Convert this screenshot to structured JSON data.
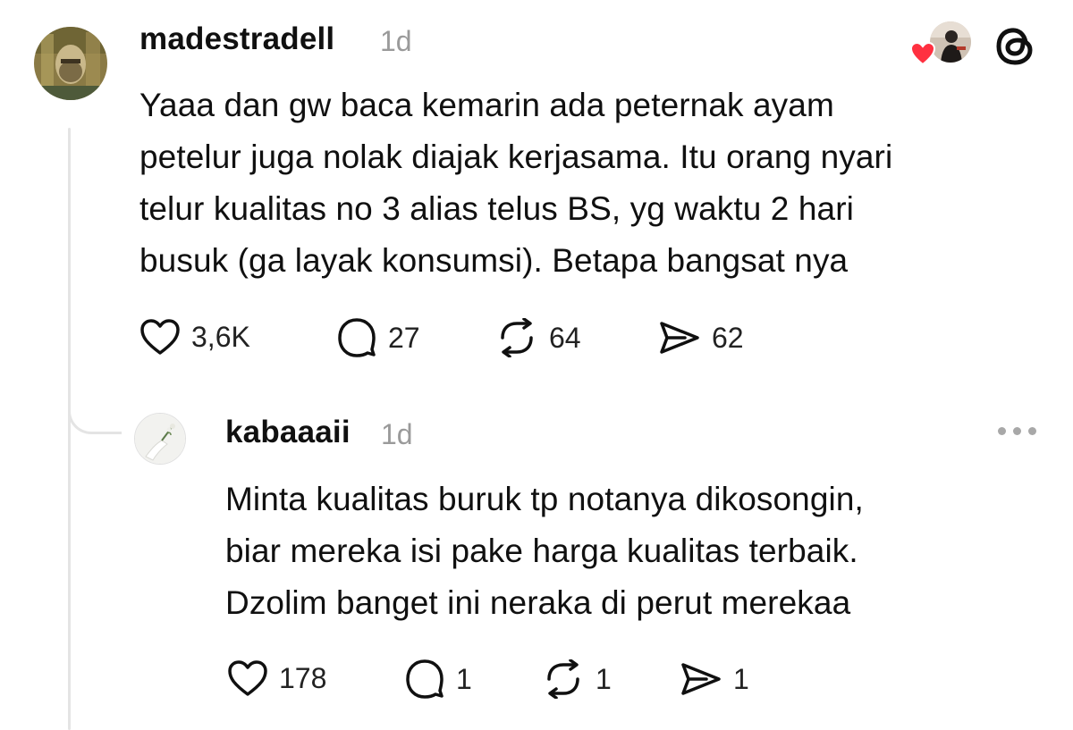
{
  "post": {
    "username": "madestradell",
    "time": "1d",
    "lines": [
      "Yaaa dan gw baca kemarin ada peternak ayam",
      "petelur juga nolak diajak kerjasama. Itu orang nyari",
      "telur kualitas no 3 alias telus BS, yg waktu 2 hari",
      "busuk (ga layak konsumsi). Betapa bangsat nya"
    ],
    "likes": "3,6K",
    "replies": "27",
    "reposts": "64",
    "shares": "62"
  },
  "reply": {
    "username": "kabaaaii",
    "time": "1d",
    "lines": [
      "Minta kualitas buruk tp notanya dikosongin,",
      "biar mereka isi pake harga kualitas terbaik.",
      "Dzolim banget ini neraka di perut merekaa"
    ],
    "likes": "178",
    "replies": "1",
    "reposts": "1",
    "shares": "1"
  },
  "colors": {
    "text": "#101010",
    "muted": "#9a9a9a",
    "heart": "#ff3040",
    "thread_line": "#e4e4e4"
  },
  "icons": {
    "like": "heart-outline-icon",
    "reply": "speech-bubble-icon",
    "repost": "repost-arrows-icon",
    "share": "send-arrow-icon",
    "app": "threads-logo-icon",
    "more": "more-dots-icon",
    "liked_badge": "heart-filled-icon"
  }
}
